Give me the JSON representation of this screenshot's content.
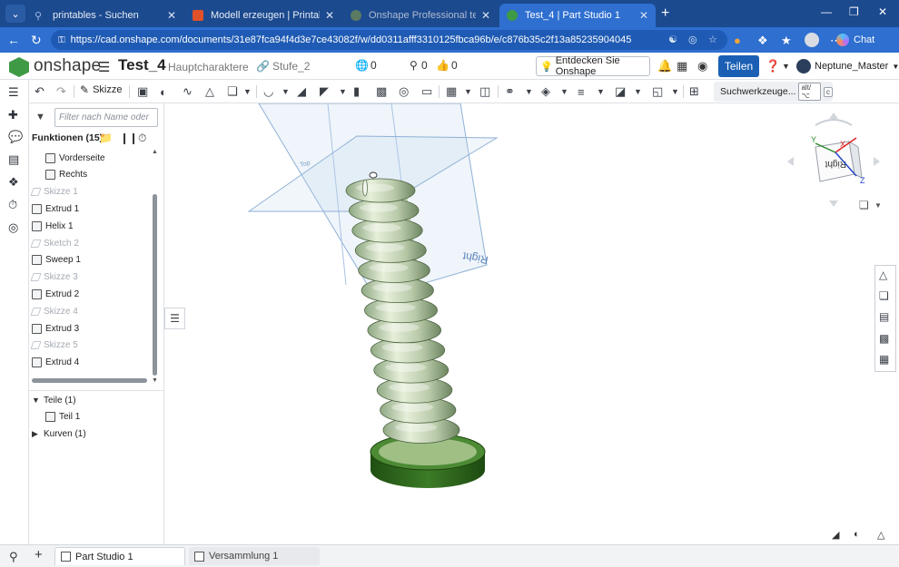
{
  "browser": {
    "tabs": [
      {
        "title": "printables - Suchen",
        "color": "#5a8de0"
      },
      {
        "title": "Modell erzeugen | Printables.com",
        "color": "#e0512a"
      },
      {
        "title": "Onshape Professional testen",
        "color": "#3f9a46"
      },
      {
        "title": "Test_4 | Part Studio 1",
        "color": "#3f9a46"
      }
    ],
    "url": "https://cad.onshape.com/documents/31e87fca94f4d3e7ce43082f/w/dd0311afff3310125fbca96b/e/c876b35c2f13a85235904045",
    "chat_label": "Chat"
  },
  "header": {
    "brand": "onshape",
    "doc_title": "Test_4",
    "branch": "Hauptcharaktere",
    "stage": "Stufe_2",
    "stats": [
      {
        "icon": "globe-icon",
        "value": "0"
      },
      {
        "icon": "pin-icon",
        "value": "0"
      },
      {
        "icon": "thumbs-up-icon",
        "value": "0"
      }
    ],
    "discover": "Entdecken Sie Onshape",
    "share": "Teilen",
    "user": "Neptune_Master"
  },
  "toolbar": {
    "sketch": "Skizze",
    "search_tools": "Suchwerkzeuge...",
    "shortcut_1": "alt/⌥",
    "shortcut_2": "c"
  },
  "panel": {
    "filter_placeholder": "Filter nach Name oder",
    "features_heading": "Funktionen (15)",
    "features": [
      {
        "label": "Vorderseite",
        "type": "plane",
        "dim": false
      },
      {
        "label": "Rechts",
        "type": "plane",
        "dim": false
      },
      {
        "label": "Skizze 1",
        "type": "sketch",
        "dim": true
      },
      {
        "label": "Extrud 1",
        "type": "extrude",
        "dim": false
      },
      {
        "label": "Helix 1",
        "type": "helix",
        "dim": false
      },
      {
        "label": "Sketch 2",
        "type": "sketch",
        "dim": true
      },
      {
        "label": "Sweep 1",
        "type": "sweep",
        "dim": false
      },
      {
        "label": "Skizze 3",
        "type": "sketch",
        "dim": true
      },
      {
        "label": "Extrud 2",
        "type": "extrude",
        "dim": false
      },
      {
        "label": "Skizze 4",
        "type": "sketch",
        "dim": true
      },
      {
        "label": "Extrud 3",
        "type": "extrude",
        "dim": false
      },
      {
        "label": "Skizze 5",
        "type": "sketch",
        "dim": true
      },
      {
        "label": "Extrud 4",
        "type": "extrude",
        "dim": false
      }
    ],
    "parts_heading": "Teile (1)",
    "part": "Teil 1",
    "curves_heading": "Kurven (1)"
  },
  "viewport": {
    "plane_label": "Right",
    "plane_label_small": "Top",
    "viewcube_face": "Right",
    "axis_x": "X",
    "axis_y": "Y",
    "axis_z": "Z",
    "model_color": "#c9d8bb",
    "base_color": "#2f6a1f"
  },
  "bottom": {
    "tabs": [
      {
        "label": "Part Studio 1",
        "active": true
      },
      {
        "label": "Versammlung 1",
        "active": false
      }
    ]
  }
}
